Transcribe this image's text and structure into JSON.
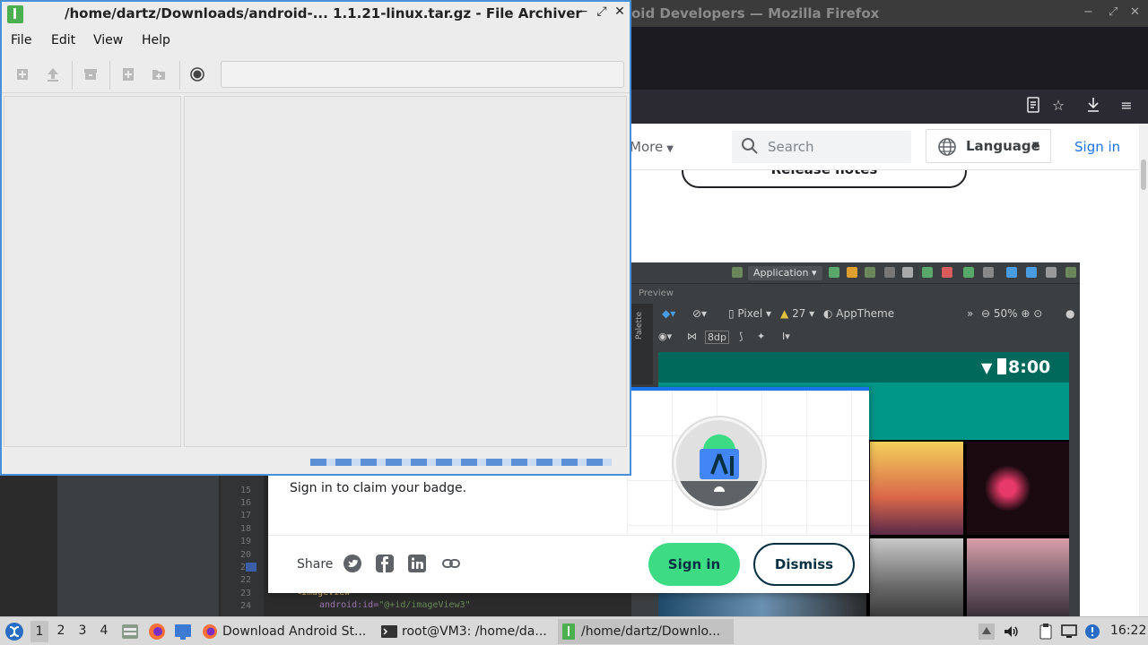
{
  "firefox": {
    "window_title": "oid Developers — Mozilla Firefox",
    "page": {
      "nav_more": "More",
      "search_placeholder": "Search",
      "language_label": "Language",
      "signin_link": "Sign in",
      "release_notes": "Release notes"
    },
    "android_studio_shot": {
      "run_config": "Application",
      "preview_label": "Preview",
      "palette_label": "Palette",
      "device": "Pixel",
      "api_level": "27",
      "theme": "AppTheme",
      "zoom": "50%",
      "margin_value": "8dp",
      "phone_time": "8:00"
    },
    "editor": {
      "line_numbers": [
        "15",
        "16",
        "17",
        "18",
        "19",
        "20",
        "21",
        "22",
        "23",
        "24"
      ],
      "code_line_23": "<ImageView",
      "code_line_24_attr": "android:id=",
      "code_line_24_val": "\"@+id/imageView3\""
    },
    "badge_dialog": {
      "message": "Sign in to claim your badge.",
      "share_label": "Share",
      "signin_button": "Sign in",
      "dismiss_button": "Dismiss"
    }
  },
  "file_archiver": {
    "title": "/home/dartz/Downloads/android-... 1.1.21-linux.tar.gz - File Archiver",
    "menu": [
      "File",
      "Edit",
      "View",
      "Help"
    ],
    "location_value": ""
  },
  "taskbar": {
    "workspaces": [
      "1",
      "2",
      "3",
      "4"
    ],
    "active_workspace": "1",
    "tasks": [
      {
        "label": "Download Android St..."
      },
      {
        "label": "root@VM3: /home/da..."
      },
      {
        "label": "/home/dartz/Downlo..."
      }
    ],
    "clock": "16:22"
  },
  "colors": {
    "android_green": "#3ddc84",
    "accent_blue": "#1a73e8",
    "archiver_border": "#4a90d9"
  }
}
